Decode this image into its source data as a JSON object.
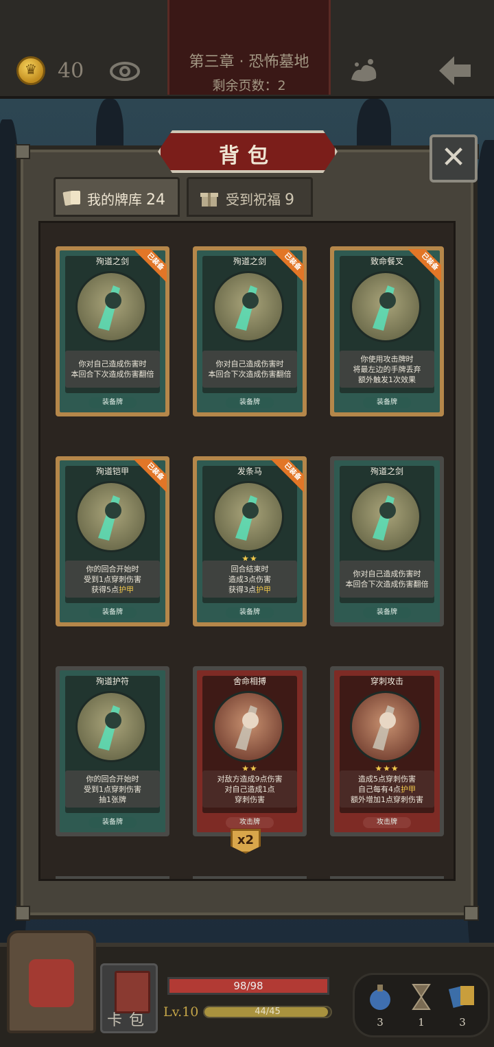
{
  "top": {
    "coins": "40",
    "chapter_title": "第三章 · 恐怖墓地",
    "pages_left": "剩余页数：2"
  },
  "panel": {
    "title": "背包",
    "close": "✕",
    "tabs": [
      {
        "label": "我的牌库",
        "count": "24"
      },
      {
        "label": "受到祝福",
        "count": "9"
      }
    ]
  },
  "cards": [
    {
      "name": "殉道之剑",
      "equipped_tag": "已装备",
      "lines": [
        "你对自己造成伤害时",
        "本回合下次造成伤害翻倍"
      ],
      "type": "装备牌"
    },
    {
      "name": "殉道之剑",
      "equipped_tag": "已装备",
      "lines": [
        "你对自己造成伤害时",
        "本回合下次造成伤害翻倍"
      ],
      "type": "装备牌"
    },
    {
      "name": "致命餐叉",
      "equipped_tag": "已装备",
      "lines": [
        "你使用攻击牌时",
        "将最左边的手牌丢弃",
        "额外触发1次效果"
      ],
      "type": "装备牌"
    },
    {
      "name": "殉道铠甲",
      "equipped_tag": "已装备",
      "lines": [
        "你的回合开始时",
        "受到1点穿刺伤害",
        "获得5点"
      ],
      "highlight": "护甲",
      "type": "装备牌"
    },
    {
      "name": "发条马",
      "equipped_tag": "已装备",
      "stars": "★★",
      "lines": [
        "回合结束时",
        "造成3点伤害",
        "获得3点"
      ],
      "highlight": "护甲",
      "type": "装备牌"
    },
    {
      "name": "殉道之剑",
      "lines": [
        "你对自己造成伤害时",
        "本回合下次造成伤害翻倍"
      ],
      "type": "装备牌"
    },
    {
      "name": "殉道护符",
      "lines": [
        "你的回合开始时",
        "受到1点穿刺伤害",
        "抽1张牌"
      ],
      "type": "装备牌"
    },
    {
      "name": "舍命相搏",
      "stars": "★★",
      "lines": [
        "对敌方造成9点伤害",
        "对自己造成1点",
        "穿刺伤害"
      ],
      "type": "攻击牌",
      "multiplier": "x2"
    },
    {
      "name": "穿刺攻击",
      "stars": "★★★",
      "lines": [
        "造成5点穿刺伤害",
        "自己每有4点",
        "额外增加1点穿刺伤害"
      ],
      "highlight": "护甲",
      "type": "攻击牌"
    }
  ],
  "bottom": {
    "cardpack_label": "卡包",
    "hp_text": "98/98",
    "hp_fraction": 1.0,
    "level": "Lv.10",
    "xp_text": "44/45",
    "xp_fraction": 0.978,
    "inventory": [
      {
        "icon": "potion-icon",
        "count": "3"
      },
      {
        "icon": "hourglass-icon",
        "count": "1"
      },
      {
        "icon": "cards-icon",
        "count": "3"
      }
    ]
  },
  "colors": {
    "equipped_ribbon": "#e27627",
    "equip_card": "#2f5a51",
    "attack_card": "#7e2b25",
    "star": "#f1c84b",
    "hp": "#b23a34"
  }
}
